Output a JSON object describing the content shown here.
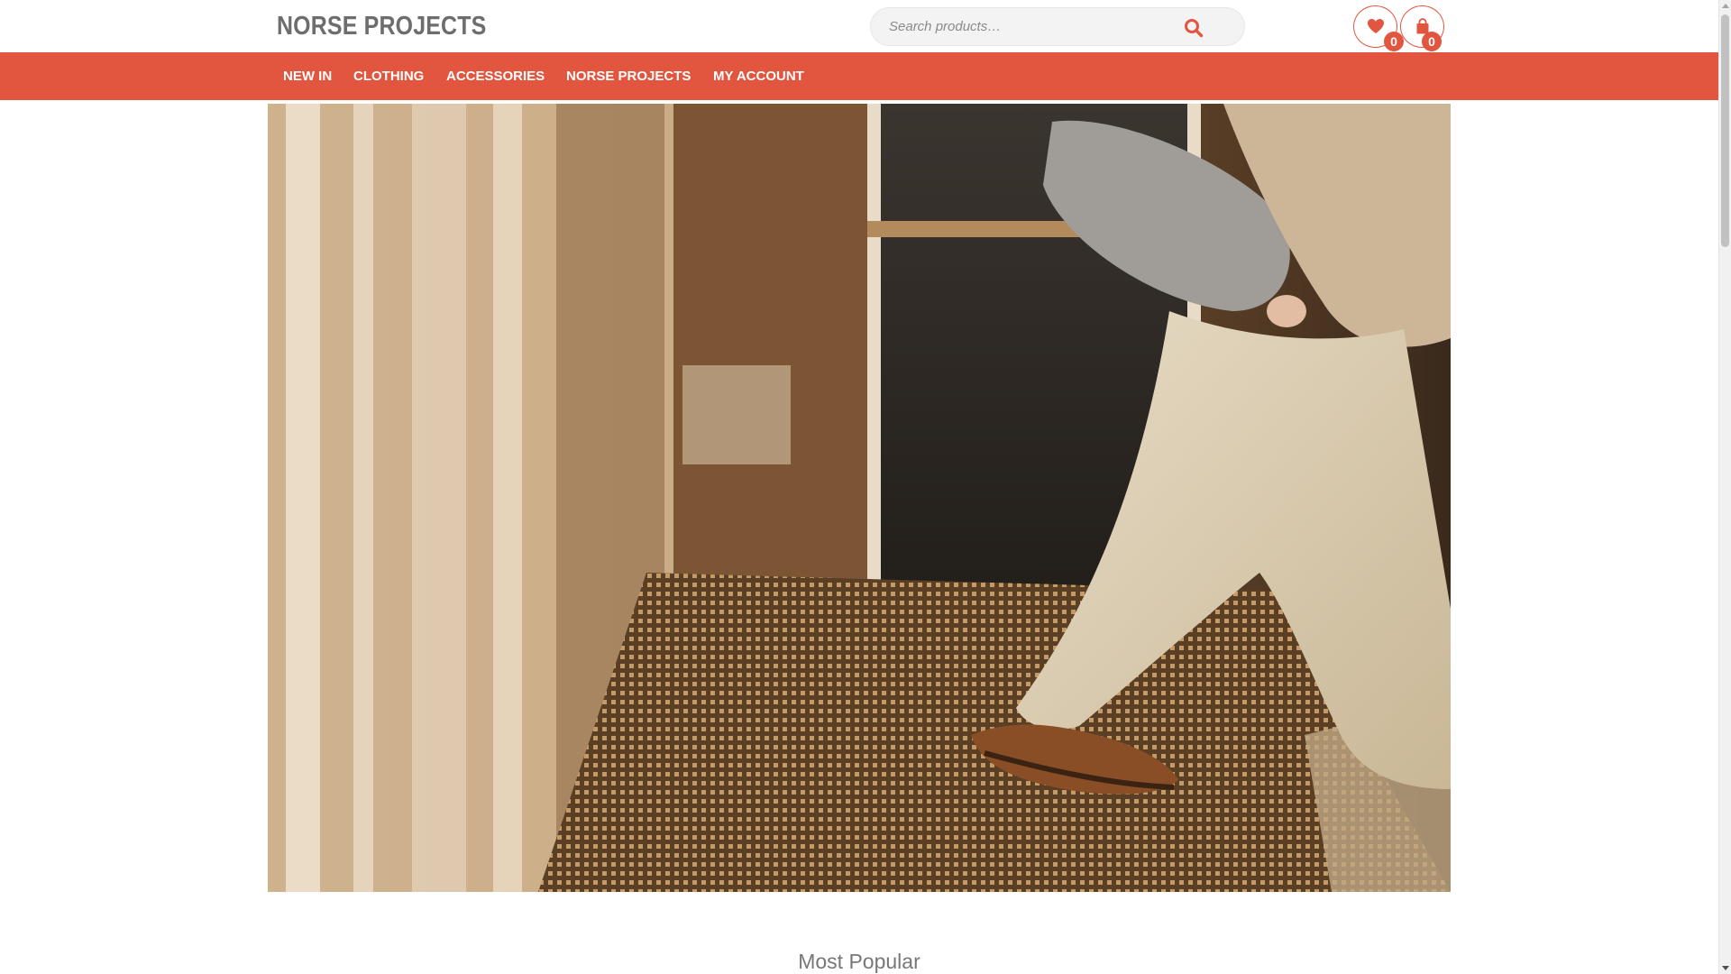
{
  "brand": {
    "logo_text": "NORSE PROJECTS",
    "accent_color": "#e2553f"
  },
  "search": {
    "placeholder": "Search products…",
    "icon": "search-icon"
  },
  "header_actions": {
    "wishlist": {
      "icon": "heart-icon",
      "count": "0"
    },
    "cart": {
      "icon": "shopping-bag-icon",
      "count": "0"
    }
  },
  "nav": {
    "items": [
      {
        "label": "NEW IN"
      },
      {
        "label": "CLOTHING"
      },
      {
        "label": "ACCESSORIES"
      },
      {
        "label": "NORSE PROJECTS"
      },
      {
        "label": "MY ACCOUNT"
      }
    ]
  },
  "hero": {
    "image": "hero-photo-person-walking-through-doorway"
  },
  "sections": {
    "most_popular_title": "Most Popular"
  }
}
